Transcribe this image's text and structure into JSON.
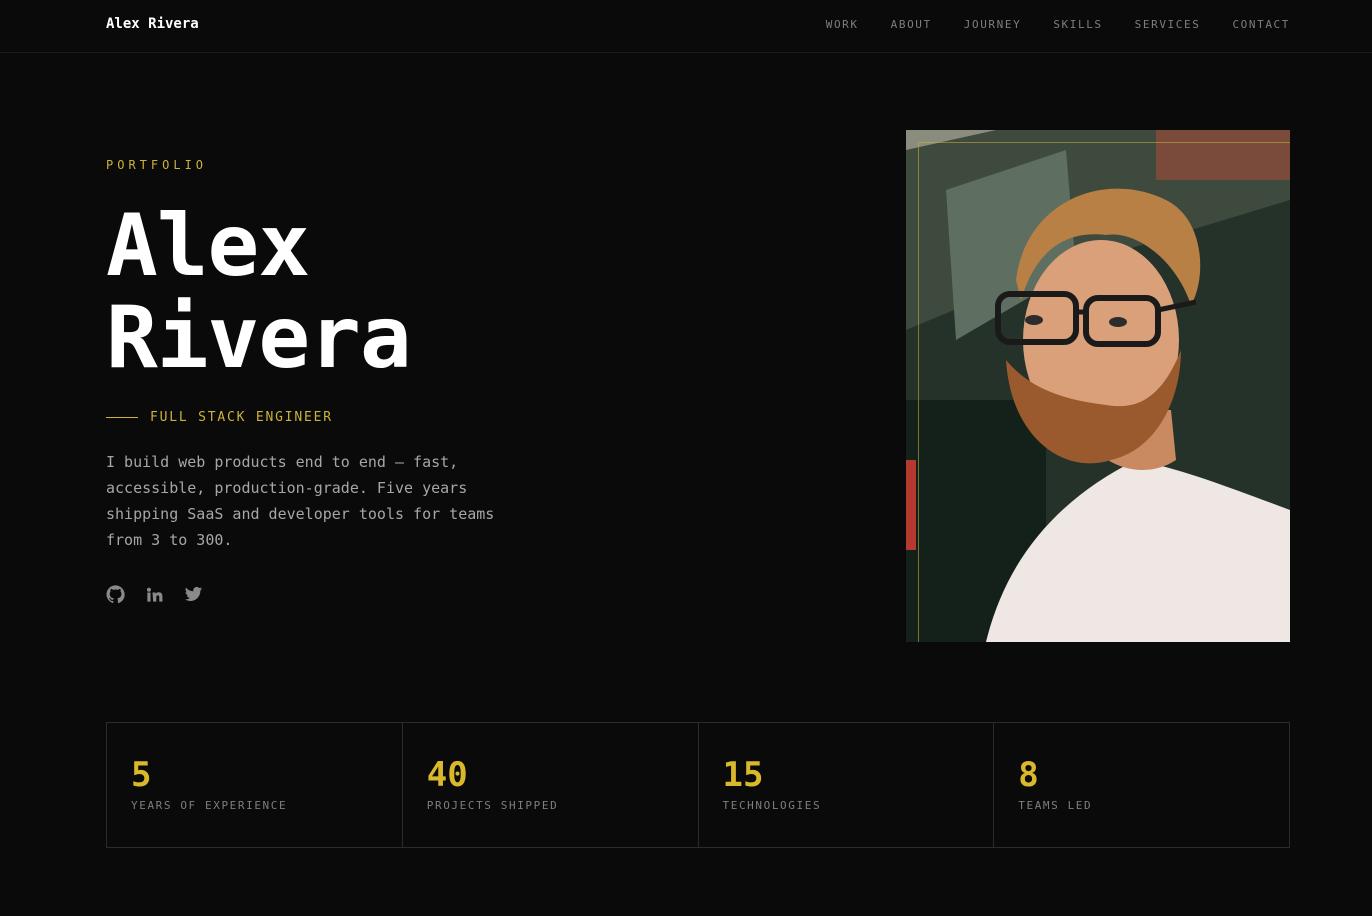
{
  "nav": {
    "brand": "Alex Rivera",
    "links": [
      "WORK",
      "ABOUT",
      "JOURNEY",
      "SKILLS",
      "SERVICES",
      "CONTACT"
    ]
  },
  "hero": {
    "eyebrow": "PORTFOLIO",
    "name_line1": "Alex",
    "name_line2": "Rivera",
    "role": "FULL STACK ENGINEER",
    "bio": "I build web products end to end — fast, accessible, production-grade. Five years shipping SaaS and developer tools for teams from 3 to 300.",
    "socials": [
      "github-icon",
      "linkedin-icon",
      "twitter-icon"
    ]
  },
  "stats": [
    {
      "value": "5",
      "label": "YEARS OF EXPERIENCE"
    },
    {
      "value": "40",
      "label": "PROJECTS SHIPPED"
    },
    {
      "value": "15",
      "label": "TECHNOLOGIES"
    },
    {
      "value": "8",
      "label": "TEAMS LED"
    }
  ],
  "colors": {
    "accent": "#cbb23a",
    "background": "#0a0a0a",
    "muted": "#7e7e7e"
  }
}
